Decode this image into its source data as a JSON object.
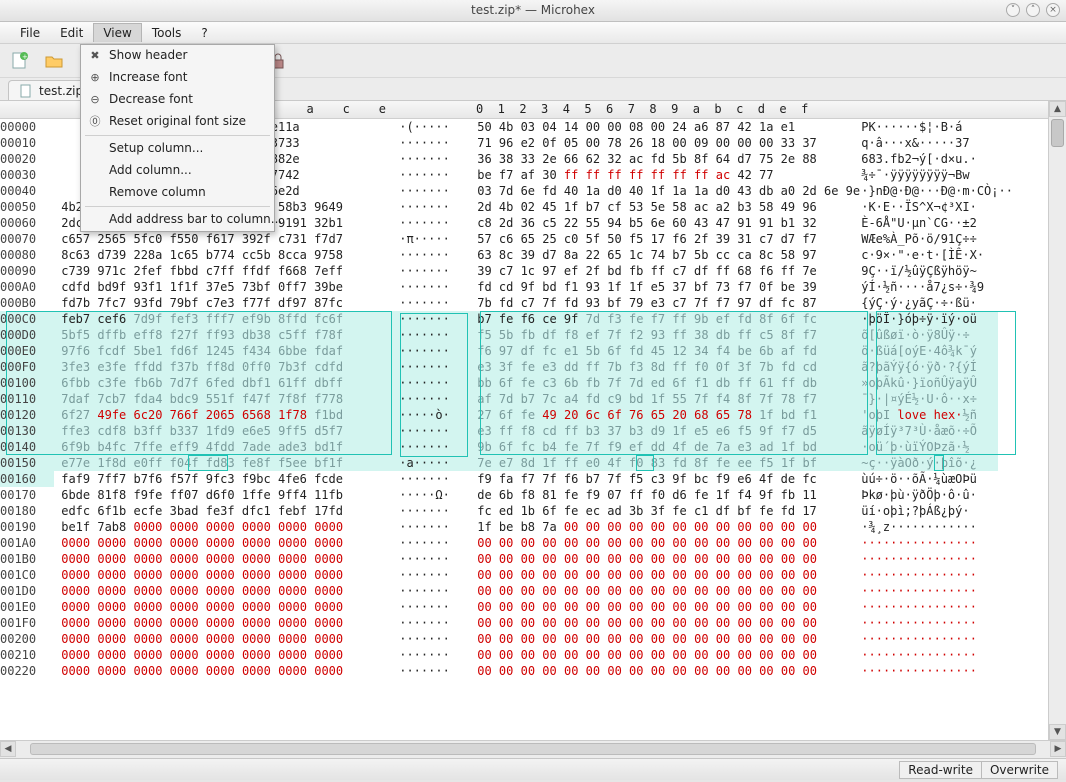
{
  "window": {
    "title": "test.zip* — Microhex"
  },
  "menubar": [
    "File",
    "Edit",
    "View",
    "Tools",
    "?"
  ],
  "view_menu": {
    "show_header": "Show header",
    "increase_font": "Increase font",
    "decrease_font": "Decrease font",
    "reset_font": "Reset original font size",
    "setup_column": "Setup column...",
    "add_column": "Add column...",
    "remove_column": "Remove column",
    "add_address_bar": "Add address bar to column..."
  },
  "tab_label": "test.zip*",
  "col_header_hex": "a    c    e",
  "col_header_bin": "0  1  2  3  4  5  6  7  8  9  a  b  c  d  e  f",
  "status": {
    "rw": "Read-write",
    "ow": "Overwrite"
  },
  "rows": [
    {
      "a": "00000",
      "h": "                   a624 4287 e11a",
      "as": "·(·····",
      "b": "50 4b 03 04 14 00 00 08 00 24 a6 87 42 1a e1",
      "t": "PK······$¦·B·á"
    },
    {
      "a": "00010",
      "h": "                   0909 0000 3733",
      "as": "·······",
      "b": "71 96 e2 0f 05 00 78 26 18 00 09 00 00 00 33 37",
      "t": "q·â···x&·····37"
    },
    {
      "a": "00020",
      "h": "                   648f 75d7 882e",
      "as": "·······",
      "b": "36 38 33 2e 66 62 32 ac fd 5b 8f 64 d7 75 2e 88",
      "t": "683.fb2¬ý[·d×u.·"
    },
    {
      "a": "00030",
      "h": "                   ffff acff 7742",
      "as": "·······",
      "b": "be f7 af 30 ff ff ff ff ff ff ff ac 42 77",
      "t": "¾÷¯·ÿÿÿÿÿÿÿÿ¬Bw",
      "redh": [
        4
      ],
      "redb": [
        4,
        5,
        6,
        7,
        8,
        9,
        10,
        11
      ]
    },
    {
      "a": "00040",
      "h": "                   4340 0000 6e2d",
      "as": "·······",
      "b": "03 7d 6e fd 40 1a d0 40 1f 1a 1a d0 43 db a0 2d 6e 9e",
      "t": "·}nÐ@·Ð@···Ð@·m·CÒ¡··"
    },
    {
      "a": "00050",
      "h": "4b2d 4502 b71f 53cf 585e a2ac 58b3 9649",
      "as": "·······",
      "b": "2d 4b 02 45 1f b7 cf 53 5e 58 ac a2 b3 58 49 96",
      "t": "·K·E··ÏS^X¬¢³XI·"
    },
    {
      "a": "00060",
      "h": "2dc8 c536 5522 b594 606e 4743 9191 32b1",
      "as": "·······",
      "b": "c8 2d 36 c5 22 55 94 b5 6e 60 43 47 91 91 b1 32",
      "t": "È-6Å\"U·µn`CG··±2"
    },
    {
      "a": "00070",
      "h": "c657 2565 5fc0 f550 f617 392f c731 f7d7",
      "as": "·π·····",
      "b": "57 c6 65 25 c0 5f 50 f5 17 f6 2f 39 31 c7 d7 f7",
      "t": "WÆe%À_Põ·ö/91Ç÷÷"
    },
    {
      "a": "00080",
      "h": "8c63 d739 228a 1c65 b774 cc5b 8cca 9758",
      "as": "·······",
      "b": "63 8c 39 d7 8a 22 65 1c 74 b7 5b cc ca 8c 58 97",
      "t": "c·9×·\"·e·t·[ÌÊ·X·"
    },
    {
      "a": "00090",
      "h": "c739 971c 2fef fbbd c7ff ffdf f668 7eff",
      "as": "·······",
      "b": "39 c7 1c 97 ef 2f bd fb ff c7 df ff 68 f6 ff 7e",
      "t": "9Ç··ï/½ûÿÇßÿhöÿ~"
    },
    {
      "a": "000A0",
      "h": "cdfd bd9f 93f1 1f1f 37e5 73bf 0ff7 39be",
      "as": "·······",
      "b": "fd cd 9f bd f1 93 1f 1f e5 37 bf 73 f7 0f be 39",
      "t": "ýÍ·½ñ····å7¿s÷·¾9"
    },
    {
      "a": "000B0",
      "h": "fd7b 7fc7 93fd 79bf c7e3 f77f df97 87fc",
      "as": "·······",
      "b": "7b fd c7 7f fd 93 bf 79 e3 c7 7f f7 97 df fc 87",
      "t": "{ýÇ·ý·¿yãÇ·÷·ßü·"
    },
    {
      "a": "000C0",
      "h": "feb7 cef6 7d9f fef3 fff7 ef9b 8ffd fc6f",
      "as": "·······",
      "b": "b7 fe f6 ce 9f 7d f3 fe f7 ff 9b ef fd 8f 6f fc",
      "t": "·þöÎ·}óþ÷ÿ·ïý·oü",
      "sel": true,
      "greyhfrom": 2,
      "greybfrom": 5
    },
    {
      "a": "000D0",
      "h": "5bf5 dffb eff8 f27f ff93 db38 c5ff f78f",
      "as": "·······",
      "b": "f5 5b fb df f8 ef 7f f2 93 ff 38 db ff c5 8f f7",
      "t": "õ[ûßøï·ò·ÿ8Ûÿ·÷",
      "sel": true,
      "grey": true
    },
    {
      "a": "000E0",
      "h": "97f6 fcdf 5be1 fd6f 1245 f434 6bbe fdaf",
      "as": "·······",
      "b": "f6 97 df fc e1 5b 6f fd 45 12 34 f4 be 6b af fd",
      "t": "ö·ßüá[oýE·4ô¾k¯ý",
      "sel": true,
      "grey": true
    },
    {
      "a": "000F0",
      "h": "3fe3 e3fe ffdd f37b ff8d 0ff0 7b3f cdfd",
      "as": "·······",
      "b": "e3 3f fe e3 dd ff 7b f3 8d ff f0 0f 3f 7b fd cd",
      "t": "ã?þãÝÿ{ó·ÿð·?{ýÍ",
      "sel": true,
      "grey": true
    },
    {
      "a": "00100",
      "h": "6fbb c3fe fb6b 7d7f 6fed dbf1 61ff dbff",
      "as": "·······",
      "b": "bb 6f fe c3 6b fb 7f 7d ed 6f f1 db ff 61 ff db",
      "t": "»oþÃkû·}ïoñÛÿaÿÛ",
      "sel": true,
      "grey": true
    },
    {
      "a": "00110",
      "h": "7daf 7cb7 fda4 bdc9 551f f47f 7f8f f778",
      "as": "·······",
      "b": "af 7d b7 7c a4 fd c9 bd 1f 55 7f f4 8f 7f 78 f7",
      "t": "¯}·|¤ýÉ½·U·ô··x÷",
      "sel": true,
      "grey": true
    },
    {
      "a": "00120",
      "h": "6f27 49fe 6c20 766f 2065 6568 1f78 f1bd",
      "as": "·····ò·",
      "b": "27 6f fe 49 20 6c 6f 76 65 20 68 65 78 1f bd f1",
      "t": "'oþI love hex·½ñ",
      "sel": true,
      "grey": true,
      "redh": [
        1,
        2,
        3,
        4,
        5,
        6
      ],
      "redb": [
        3,
        4,
        5,
        6,
        7,
        8,
        9,
        10,
        11,
        12
      ],
      "redt": [
        4,
        5,
        6,
        7,
        8,
        9,
        10,
        11,
        12,
        13
      ]
    },
    {
      "a": "00130",
      "h": "ffe3 cdf8 b3ff b337 1fd9 e6e5 9ff5 d5f7",
      "as": "·······",
      "b": "e3 ff f8 cd ff b3 37 b3 d9 1f e5 e6 f5 9f f7 d5",
      "t": "ãÿøÍÿ³7³Ù·åæõ·÷Õ",
      "sel": true,
      "grey": true
    },
    {
      "a": "00140",
      "h": "6f9b b4fc 7ffe eff9 4fdd 7ade ade3 bd1f",
      "as": "·······",
      "b": "9b 6f fc b4 fe 7f f9 ef dd 4f de 7a e3 ad 1f bd",
      "t": "·oü´þ·ùïÝOÞzã­·½",
      "sel": true,
      "grey": true
    },
    {
      "a": "00150",
      "h": "e77e 1f8d e0ff f04f fd83 fe8f f5ee bf1f",
      "as": "·a·····",
      "b": "7e e7 8d 1f ff e0 4f f0 83 fd 8f fe ee f5 1f bf",
      "t": "~ç··ÿàOð·ý·þîõ·¿",
      "sel": true,
      "grey": true
    },
    {
      "a": "00160",
      "h": "faf9 7ff7 b7f6 f57f 9fc3 f9bc 4fe6 fcde",
      "as": "·······",
      "b": "f9 fa f7 7f f6 b7 7f f5 c3 9f bc f9 e6 4f de fc",
      "t": "ùú÷·ö··õÃ·¼ùæOÞü",
      "partial": true
    },
    {
      "a": "00170",
      "h": "6bde 81f8 f9fe ff07 d6f0 1ffe 9ff4 11fb",
      "as": "·····Ω·",
      "b": "de 6b f8 81 fe f9 07 ff f0 d6 fe 1f f4 9f fb 11",
      "t": "Þkø·þù·ÿðÖþ·ô·û·"
    },
    {
      "a": "00180",
      "h": "edfc 6f1b ecfe 3bad fe3f dfc1 febf 17fd",
      "as": "·······",
      "b": "fc ed 1b 6f fe ec ad 3b 3f fe c1 df bf fe fd 17",
      "t": "üí·oþì­;?þÁß¿þý·"
    },
    {
      "a": "00190",
      "h": "be1f 7ab8 0000 0000 0000 0000 0000 0000",
      "as": "·······",
      "b": "1f be b8 7a 00 00 00 00 00 00 00 00 00 00 00 00",
      "t": "·¾¸z············",
      "redh": [
        2,
        3,
        4,
        5,
        6,
        7
      ],
      "redb": [
        4,
        5,
        6,
        7,
        8,
        9,
        10,
        11,
        12,
        13,
        14,
        15
      ]
    },
    {
      "a": "001A0",
      "h": "0000 0000 0000 0000 0000 0000 0000 0000",
      "as": "·······",
      "b": "00 00 00 00 00 00 00 00 00 00 00 00 00 00 00 00",
      "t": "················",
      "allred": true
    },
    {
      "a": "001B0",
      "h": "0000 0000 0000 0000 0000 0000 0000 0000",
      "as": "·······",
      "b": "00 00 00 00 00 00 00 00 00 00 00 00 00 00 00 00",
      "t": "················",
      "allred": true
    },
    {
      "a": "001C0",
      "h": "0000 0000 0000 0000 0000 0000 0000 0000",
      "as": "·······",
      "b": "00 00 00 00 00 00 00 00 00 00 00 00 00 00 00 00",
      "t": "················",
      "allred": true
    },
    {
      "a": "001D0",
      "h": "0000 0000 0000 0000 0000 0000 0000 0000",
      "as": "·······",
      "b": "00 00 00 00 00 00 00 00 00 00 00 00 00 00 00 00",
      "t": "················",
      "allred": true
    },
    {
      "a": "001E0",
      "h": "0000 0000 0000 0000 0000 0000 0000 0000",
      "as": "·······",
      "b": "00 00 00 00 00 00 00 00 00 00 00 00 00 00 00 00",
      "t": "················",
      "allred": true
    },
    {
      "a": "001F0",
      "h": "0000 0000 0000 0000 0000 0000 0000 0000",
      "as": "·······",
      "b": "00 00 00 00 00 00 00 00 00 00 00 00 00 00 00 00",
      "t": "················",
      "allred": true
    },
    {
      "a": "00200",
      "h": "0000 0000 0000 0000 0000 0000 0000 0000",
      "as": "·······",
      "b": "00 00 00 00 00 00 00 00 00 00 00 00 00 00 00 00",
      "t": "················",
      "allred": true
    },
    {
      "a": "00210",
      "h": "0000 0000 0000 0000 0000 0000 0000 0000",
      "as": "·······",
      "b": "00 00 00 00 00 00 00 00 00 00 00 00 00 00 00 00",
      "t": "················",
      "allred": true
    },
    {
      "a": "00220",
      "h": "0000 0000 0000 0000 0000 0000 0000 0000",
      "as": "·······",
      "b": "00 00 00 00 00 00 00 00 00 00 00 00 00 00 00 00",
      "t": "················",
      "allred": true
    }
  ]
}
